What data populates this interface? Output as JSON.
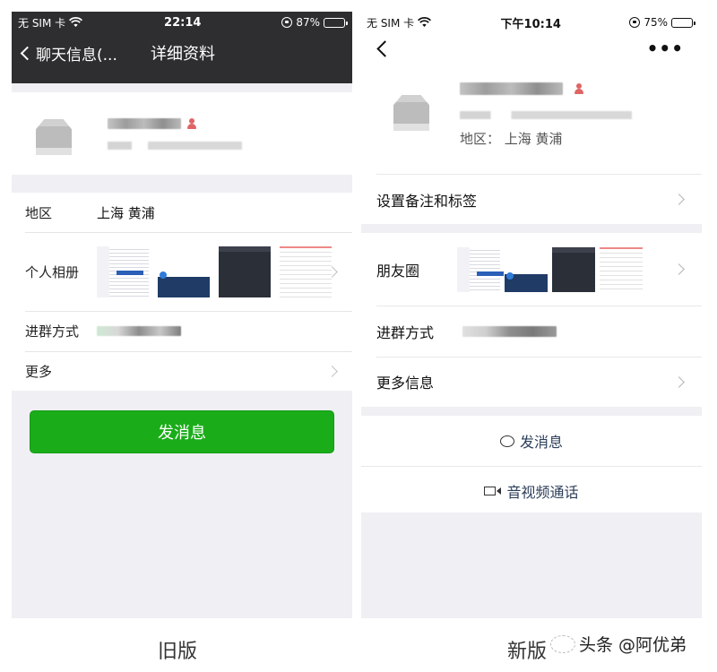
{
  "old": {
    "caption": "旧版",
    "status": {
      "carrier": "无 SIM 卡",
      "time": "22:14",
      "battery": "87%",
      "battery_level": 0.87
    },
    "nav": {
      "back_label": "聊天信息(...",
      "title": "详细资料"
    },
    "profile": {
      "name": "[blurred]",
      "wechat_id": "[blurred]"
    },
    "rows": [
      {
        "label": "地区",
        "value": "上海 黄浦"
      },
      {
        "label": "个人相册",
        "value": "",
        "has_arrow": true,
        "thumbnails": 4
      },
      {
        "label": "进群方式",
        "value": "[blurred]"
      },
      {
        "label": "更多",
        "value": "",
        "has_arrow": true
      }
    ],
    "send_button": "发消息",
    "accent": "#1aad19",
    "header_bg": "#2e2e30"
  },
  "new": {
    "caption": "新版",
    "status": {
      "carrier": "无 SIM 卡",
      "time": "下午10:14",
      "battery": "75%",
      "battery_level": 0.75
    },
    "nav": {
      "more": "•••"
    },
    "profile": {
      "name": "[blurred]",
      "wechat_id": "[blurred]",
      "region": "地区：  上海 黄浦"
    },
    "rows": [
      {
        "label": "设置备注和标签",
        "has_arrow": true
      },
      {
        "label": "朋友圈",
        "has_arrow": true,
        "thumbnails": 4
      },
      {
        "label": "进群方式",
        "value": "[blurred]"
      },
      {
        "label": "更多信息",
        "has_arrow": true
      }
    ],
    "actions": [
      {
        "icon": "chat-bubble-icon",
        "label": "发消息"
      },
      {
        "icon": "video-camera-icon",
        "label": "音视频通话"
      }
    ]
  },
  "watermark": "头条 @阿优弟"
}
